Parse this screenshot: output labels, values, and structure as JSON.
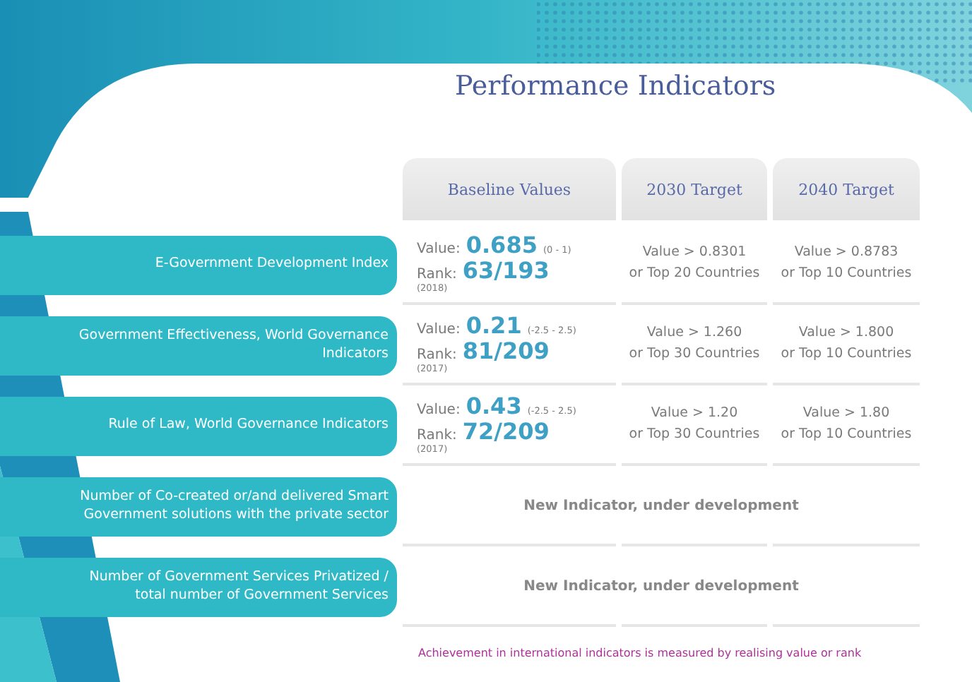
{
  "title": "Performance Indicators",
  "columns": [
    "Baseline Values",
    "2030 Target",
    "2040 Target"
  ],
  "rows": [
    {
      "indicator": "E-Government Development Index",
      "kind": "measured",
      "value_label": "Value:",
      "value": "0.685",
      "range": "(0 - 1)",
      "rank_label": "Rank:",
      "rank": "63/193",
      "year": "(2018)",
      "targets": [
        [
          "Value > 0.8301",
          "or Top 20 Countries"
        ],
        [
          "Value > 0.8783",
          "or Top 10 Countries"
        ]
      ]
    },
    {
      "indicator": "Government Effectiveness, World Governance Indicators",
      "kind": "measured",
      "value_label": "Value:",
      "value": "0.21",
      "range": "(-2.5 - 2.5)",
      "rank_label": "Rank:",
      "rank": "81/209",
      "year": "(2017)",
      "targets": [
        [
          "Value > 1.260",
          "or Top 30 Countries"
        ],
        [
          "Value > 1.800",
          "or Top 10 Countries"
        ]
      ]
    },
    {
      "indicator": "Rule of Law, World Governance Indicators",
      "kind": "measured",
      "value_label": "Value:",
      "value": "0.43",
      "range": "(-2.5 - 2.5)",
      "rank_label": "Rank:",
      "rank": "72/209",
      "year": "(2017)",
      "targets": [
        [
          "Value > 1.20",
          "or Top 30 Countries"
        ],
        [
          "Value > 1.80",
          "or Top 10 Countries"
        ]
      ]
    },
    {
      "indicator": "Number of Co-created or/and delivered Smart Government solutions with the private sector",
      "kind": "new",
      "note": "New Indicator, under development"
    },
    {
      "indicator": "Number of Government Services Privatized / total number of Government Services",
      "kind": "new",
      "note": "New Indicator, under development"
    }
  ],
  "footnote": "Achievement in international indicators is measured by realising value or rank"
}
